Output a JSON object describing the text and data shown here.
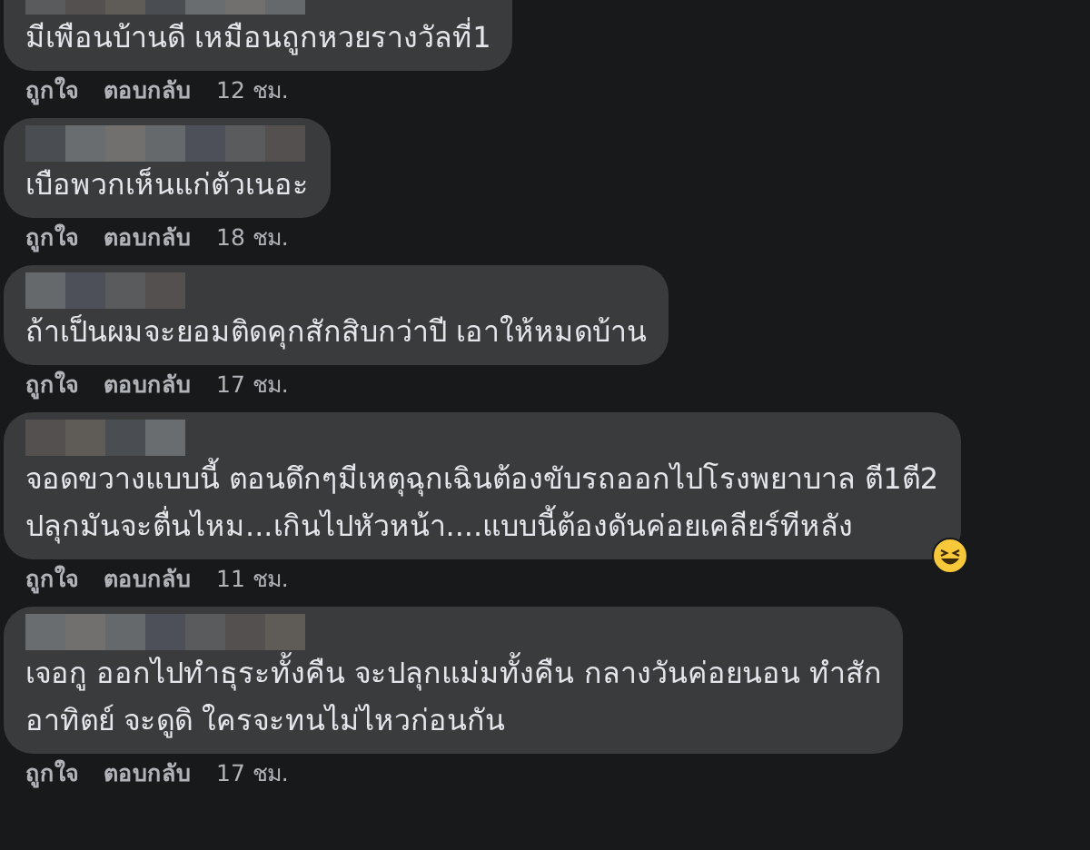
{
  "comments": [
    {
      "lines": [
        "มีเพือนบ้านดี เหมือนถูกหวยรางวัลที่1"
      ],
      "like": "ถูกใจ",
      "reply": "ตอบกลับ",
      "time": "12 ชม.",
      "laugh_reaction": false
    },
    {
      "lines": [
        "เบือพวกเห็นแก่ตัวเนอะ"
      ],
      "like": "ถูกใจ",
      "reply": "ตอบกลับ",
      "time": "18 ชม.",
      "laugh_reaction": false
    },
    {
      "lines": [
        "ถ้าเป็นผมจะยอมติดคุกสักสิบกว่าปี เอาให้หมดบ้าน"
      ],
      "like": "ถูกใจ",
      "reply": "ตอบกลับ",
      "time": "17 ชม.",
      "laugh_reaction": false
    },
    {
      "lines": [
        "จอดขวางแบบนี้ ตอนดึกๆมีเหตุฉุกเฉินต้องขับรถออกไปโรงพยาบาล ตี1ตี2",
        "ปลุกมันจะตื่นไหม...เกินไปหัวหน้า....แบบนี้ต้องดันค่อยเคลียร์ทีหลัง"
      ],
      "like": "ถูกใจ",
      "reply": "ตอบกลับ",
      "time": "11 ชม.",
      "laugh_reaction": true
    },
    {
      "lines": [
        "เจอกู ออกไปทำธุระทั้งคืน จะปลุกแม่มทั้งคืน กลางวันค่อยนอน ทำสัก",
        "อาทิตย์ จะดูดิ ใครจะทนไม่ไหวก่อนกัน"
      ],
      "like": "ถูกใจ",
      "reply": "ตอบกลับ",
      "time": "17 ชม.",
      "laugh_reaction": false
    }
  ]
}
